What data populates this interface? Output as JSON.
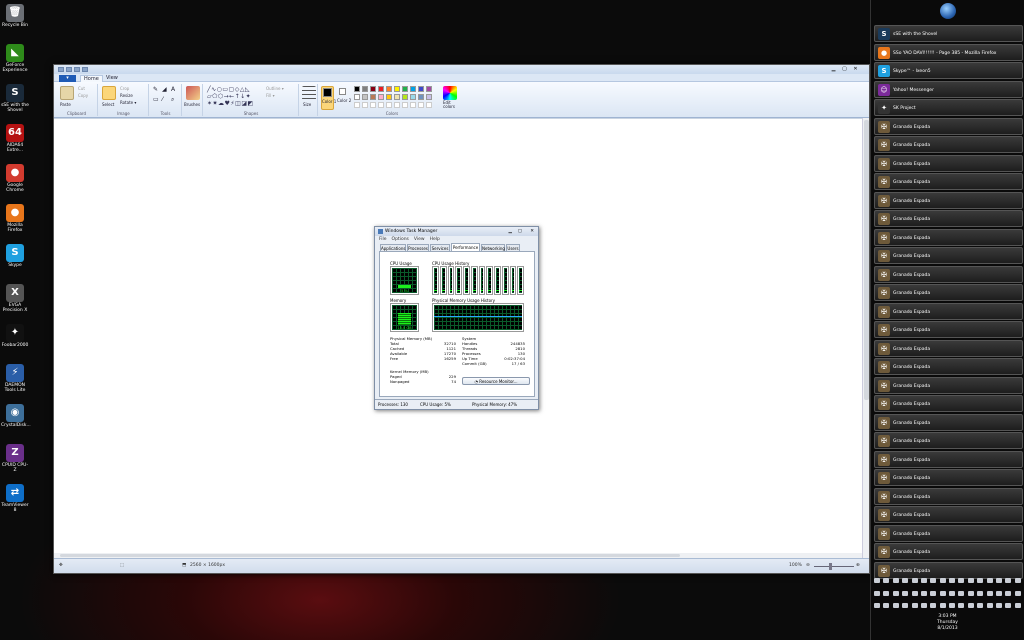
{
  "desktop": {
    "icons": [
      {
        "label": "Recycle Bin",
        "glyph": "🗑",
        "color": "#6b6f75"
      },
      {
        "label": "GeForce Experience",
        "glyph": "◣",
        "color": "#2e8b1a"
      },
      {
        "label": "sSE with the Shovel",
        "glyph": "S",
        "color": "#1a2a3a"
      },
      {
        "label": "AIDA64 Extre...",
        "glyph": "64",
        "color": "#b51212"
      },
      {
        "label": "Google Chrome",
        "glyph": "●",
        "color": "#d23b2f"
      },
      {
        "label": "Mozilla Firefox",
        "glyph": "●",
        "color": "#e8761b"
      },
      {
        "label": "Skype",
        "glyph": "S",
        "color": "#1fa0e0"
      },
      {
        "label": "EVGA Precision X",
        "glyph": "X",
        "color": "#555"
      },
      {
        "label": "Foobar2000",
        "glyph": "✦",
        "color": "#111"
      },
      {
        "label": "DAEMON Tools Lite",
        "glyph": "⚡",
        "color": "#2a5ea8"
      },
      {
        "label": "CrystalDisk...",
        "glyph": "◉",
        "color": "#3d6f9a"
      },
      {
        "label": "CPUID CPU-Z",
        "glyph": "Z",
        "color": "#6a2f8a"
      },
      {
        "label": "TeamViewer 8",
        "glyph": "⇄",
        "color": "#0e6ec8"
      }
    ]
  },
  "paint": {
    "tabs": {
      "file": "▾",
      "home": "Home",
      "view": "View"
    },
    "groups": {
      "clipboard": "Clipboard",
      "image": "Image",
      "tools": "Tools",
      "shapes": "Shapes",
      "colors": "Colors"
    },
    "buttons": {
      "paste": "Paste",
      "cut": "Cut",
      "copy": "Copy",
      "select": "Select",
      "crop": "Crop",
      "resize": "Resize",
      "rotate": "Rotate ▾",
      "brushes": "Brushes",
      "outline": "Outline ▾",
      "fill": "Fill ▾",
      "size": "Size",
      "color1": "Color 1",
      "color2": "Color 2",
      "edit_colors": "Edit colors"
    },
    "palette": [
      "#000000",
      "#7f7f7f",
      "#880015",
      "#ed1c24",
      "#ff7f27",
      "#fff200",
      "#22b14c",
      "#00a2e8",
      "#3f48cc",
      "#a349a4",
      "#ffffff",
      "#c3c3c3",
      "#b97a57",
      "#ffaec9",
      "#ffc90e",
      "#efe4b0",
      "#b5e61d",
      "#99d9ea",
      "#7092be",
      "#c8bfe7"
    ],
    "status": {
      "size": "2560 × 1600px",
      "zoom": "100%"
    }
  },
  "taskmanager": {
    "title": "Windows Task Manager",
    "menu": [
      "File",
      "Options",
      "View",
      "Help"
    ],
    "tabs": [
      "Applications",
      "Processes",
      "Services",
      "Performance",
      "Networking",
      "Users"
    ],
    "active_tab": "Performance",
    "labels": {
      "cpu_usage": "CPU Usage",
      "cpu_history": "CPU Usage History",
      "memory": "Memory",
      "mem_history": "Physical Memory Usage History"
    },
    "cpu_value": "5 %",
    "mem_value": "15.0 GB",
    "cpu_cores": 12,
    "physical": {
      "header": "Physical Memory (MB)",
      "rows": [
        [
          "Total",
          "32710"
        ],
        [
          "Cached",
          "1121"
        ],
        [
          "Available",
          "17270"
        ],
        [
          "Free",
          "16259"
        ]
      ]
    },
    "system": {
      "header": "System",
      "rows": [
        [
          "Handles",
          "244835"
        ],
        [
          "Threads",
          "2810"
        ],
        [
          "Processes",
          "130"
        ],
        [
          "Up Time",
          "0:02:37:04"
        ],
        [
          "Commit (GB)",
          "17 / 63"
        ]
      ]
    },
    "kernel": {
      "header": "Kernel Memory (MB)",
      "rows": [
        [
          "Paged",
          "229"
        ],
        [
          "Nonpaged",
          "74"
        ]
      ]
    },
    "resource_btn": "Resource Monitor...",
    "statusbar": {
      "processes": "Processes: 130",
      "cpu": "CPU Usage: 5%",
      "memory": "Physical Memory: 47%"
    }
  },
  "taskbar": {
    "items": [
      {
        "label": "sSE with the Shovel",
        "glyph": "S",
        "color": "#1a3a5a"
      },
      {
        "label": "SSo YAO DAVI!!!!!! - Page 385 - Mozilla Firefox",
        "glyph": "●",
        "color": "#e8761b"
      },
      {
        "label": "Skype™ - Ixeon5",
        "glyph": "S",
        "color": "#1fa0e0"
      },
      {
        "label": "Yahoo! Messenger",
        "glyph": "☺",
        "color": "#7b2a9a"
      },
      {
        "label": "SK Project",
        "glyph": "✦",
        "color": "#333"
      },
      {
        "label": "Granado Espada",
        "glyph": "✠",
        "color": "#6e5a3a"
      },
      {
        "label": "Granado Espada",
        "glyph": "✠",
        "color": "#6e5a3a"
      },
      {
        "label": "Granado Espada",
        "glyph": "✠",
        "color": "#6e5a3a"
      },
      {
        "label": "Granado Espada",
        "glyph": "✠",
        "color": "#6e5a3a"
      },
      {
        "label": "Granado Espada",
        "glyph": "✠",
        "color": "#6e5a3a"
      },
      {
        "label": "Granado Espada",
        "glyph": "✠",
        "color": "#6e5a3a"
      },
      {
        "label": "Granado Espada",
        "glyph": "✠",
        "color": "#6e5a3a"
      },
      {
        "label": "Granado Espada",
        "glyph": "✠",
        "color": "#6e5a3a"
      },
      {
        "label": "Granado Espada",
        "glyph": "✠",
        "color": "#6e5a3a"
      },
      {
        "label": "Granado Espada",
        "glyph": "✠",
        "color": "#6e5a3a"
      },
      {
        "label": "Granado Espada",
        "glyph": "✠",
        "color": "#6e5a3a"
      },
      {
        "label": "Granado Espada",
        "glyph": "✠",
        "color": "#6e5a3a"
      },
      {
        "label": "Granado Espada",
        "glyph": "✠",
        "color": "#6e5a3a"
      },
      {
        "label": "Granado Espada",
        "glyph": "✠",
        "color": "#6e5a3a"
      },
      {
        "label": "Granado Espada",
        "glyph": "✠",
        "color": "#6e5a3a"
      },
      {
        "label": "Granado Espada",
        "glyph": "✠",
        "color": "#6e5a3a"
      },
      {
        "label": "Granado Espada",
        "glyph": "✠",
        "color": "#6e5a3a"
      },
      {
        "label": "Granado Espada",
        "glyph": "✠",
        "color": "#6e5a3a"
      },
      {
        "label": "Granado Espada",
        "glyph": "✠",
        "color": "#6e5a3a"
      },
      {
        "label": "Granado Espada",
        "glyph": "✠",
        "color": "#6e5a3a"
      },
      {
        "label": "Granado Espada",
        "glyph": "✠",
        "color": "#6e5a3a"
      },
      {
        "label": "Granado Espada",
        "glyph": "✠",
        "color": "#6e5a3a"
      },
      {
        "label": "Granado Espada",
        "glyph": "✠",
        "color": "#6e5a3a"
      },
      {
        "label": "Granado Espada",
        "glyph": "✠",
        "color": "#6e5a3a"
      },
      {
        "label": "Granado Espada",
        "glyph": "✠",
        "color": "#6e5a3a"
      }
    ],
    "clock": {
      "time": "3:03 PM",
      "day": "Thursday",
      "date": "8/1/2013"
    }
  }
}
